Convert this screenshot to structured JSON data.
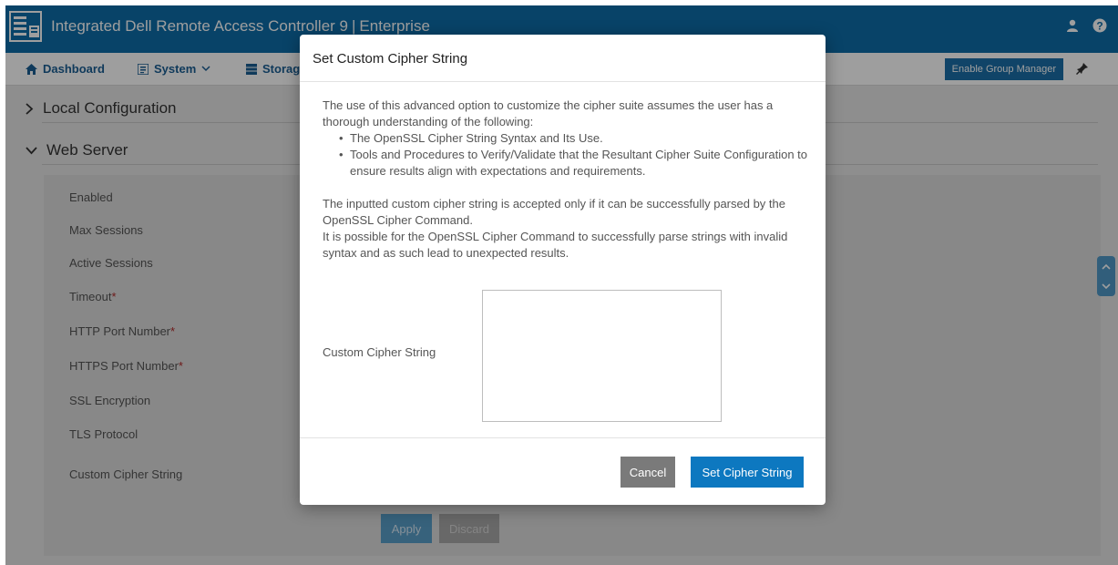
{
  "header": {
    "title": "Integrated Dell Remote Access Controller 9",
    "edition": "Enterprise",
    "icons": [
      "server-logo-icon",
      "user-icon",
      "help-icon"
    ]
  },
  "nav": {
    "dashboard": "Dashboard",
    "system": "System",
    "storage": "Storage",
    "enable_group_manager": "Enable Group Manager"
  },
  "sections": {
    "local_configuration": "Local Configuration",
    "web_server": "Web Server"
  },
  "fields": [
    {
      "label": "Enabled",
      "required": false
    },
    {
      "label": "Max Sessions",
      "required": false
    },
    {
      "label": "Active Sessions",
      "required": false
    },
    {
      "label": "Timeout",
      "required": true
    },
    {
      "label": "HTTP Port Number",
      "required": true
    },
    {
      "label": "HTTPS Port Number",
      "required": true
    },
    {
      "label": "SSL Encryption",
      "required": false
    },
    {
      "label": "TLS Protocol",
      "required": false
    },
    {
      "label": "Custom Cipher String",
      "required": false
    }
  ],
  "form_buttons": {
    "apply": "Apply",
    "discard": "Discard"
  },
  "modal": {
    "title": "Set Custom Cipher String",
    "intro": "The use of this advanced option to customize the cipher suite assumes the user has a thorough understanding of the following:",
    "bullets": [
      "The OpenSSL Cipher String Syntax and Its Use.",
      "Tools and Procedures to Verify/Validate that the Resultant Cipher Suite Configuration to ensure results align with expectations and requirements."
    ],
    "para2_line1": "The inputted custom cipher string is accepted only if it can be successfully parsed by the OpenSSL Cipher Command.",
    "para2_line2": "It is possible for the OpenSSL Cipher Command to successfully parse strings with invalid syntax and as such lead to unexpected results.",
    "field_label": "Custom Cipher String",
    "field_value": "",
    "cancel": "Cancel",
    "submit": "Set Cipher String"
  },
  "colors": {
    "header_bg": "#0d6ca9",
    "nav_text": "#1a5e94",
    "primary_button": "#0d78c0",
    "cancel_button": "#7a7a7a",
    "required_marker": "#b02a2a"
  }
}
